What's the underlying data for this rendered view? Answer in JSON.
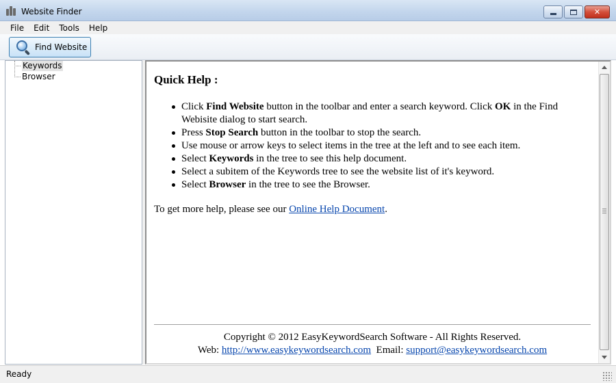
{
  "window": {
    "title": "Website Finder"
  },
  "menu": [
    "File",
    "Edit",
    "Tools",
    "Help"
  ],
  "toolbar": {
    "find_label": "Find Website"
  },
  "tree": {
    "items": [
      "Keywords",
      "Browser"
    ],
    "selected": "Keywords"
  },
  "help": {
    "heading": "Quick Help :",
    "items": [
      {
        "pre": "Click ",
        "bold": "Find Website",
        "mid": " button in the toolbar and enter a search keyword. Click ",
        "bold2": "OK",
        "post": " in the Find Webisite dialog to start search."
      },
      {
        "pre": "Press ",
        "bold": "Stop Search",
        "post": " button in the toolbar to stop the search."
      },
      {
        "pre": "Use mouse or arrow keys to select items in the tree at the left and to see each item.",
        "bold": "",
        "post": ""
      },
      {
        "pre": "Select ",
        "bold": "Keywords",
        "post": " in the tree to see this help document."
      },
      {
        "pre": "Select a subitem of the Keywords tree to see the website list of it's keyword.",
        "bold": "",
        "post": ""
      },
      {
        "pre": "Select ",
        "bold": "Browser",
        "post": " in the tree to see the Browser."
      }
    ],
    "more_pre": "To get more help, please see our ",
    "more_link": "Online Help Document",
    "more_post": ".",
    "copyright": "Copyright © 2012  EasyKeywordSearch Software - All Rights Reserved.",
    "web_label": "Web: ",
    "web_link": "http://www.easykeywordsearch.com",
    "email_label": "  Email: ",
    "email_link": "support@easykeywordsearch.com"
  },
  "status": {
    "text": "Ready"
  }
}
